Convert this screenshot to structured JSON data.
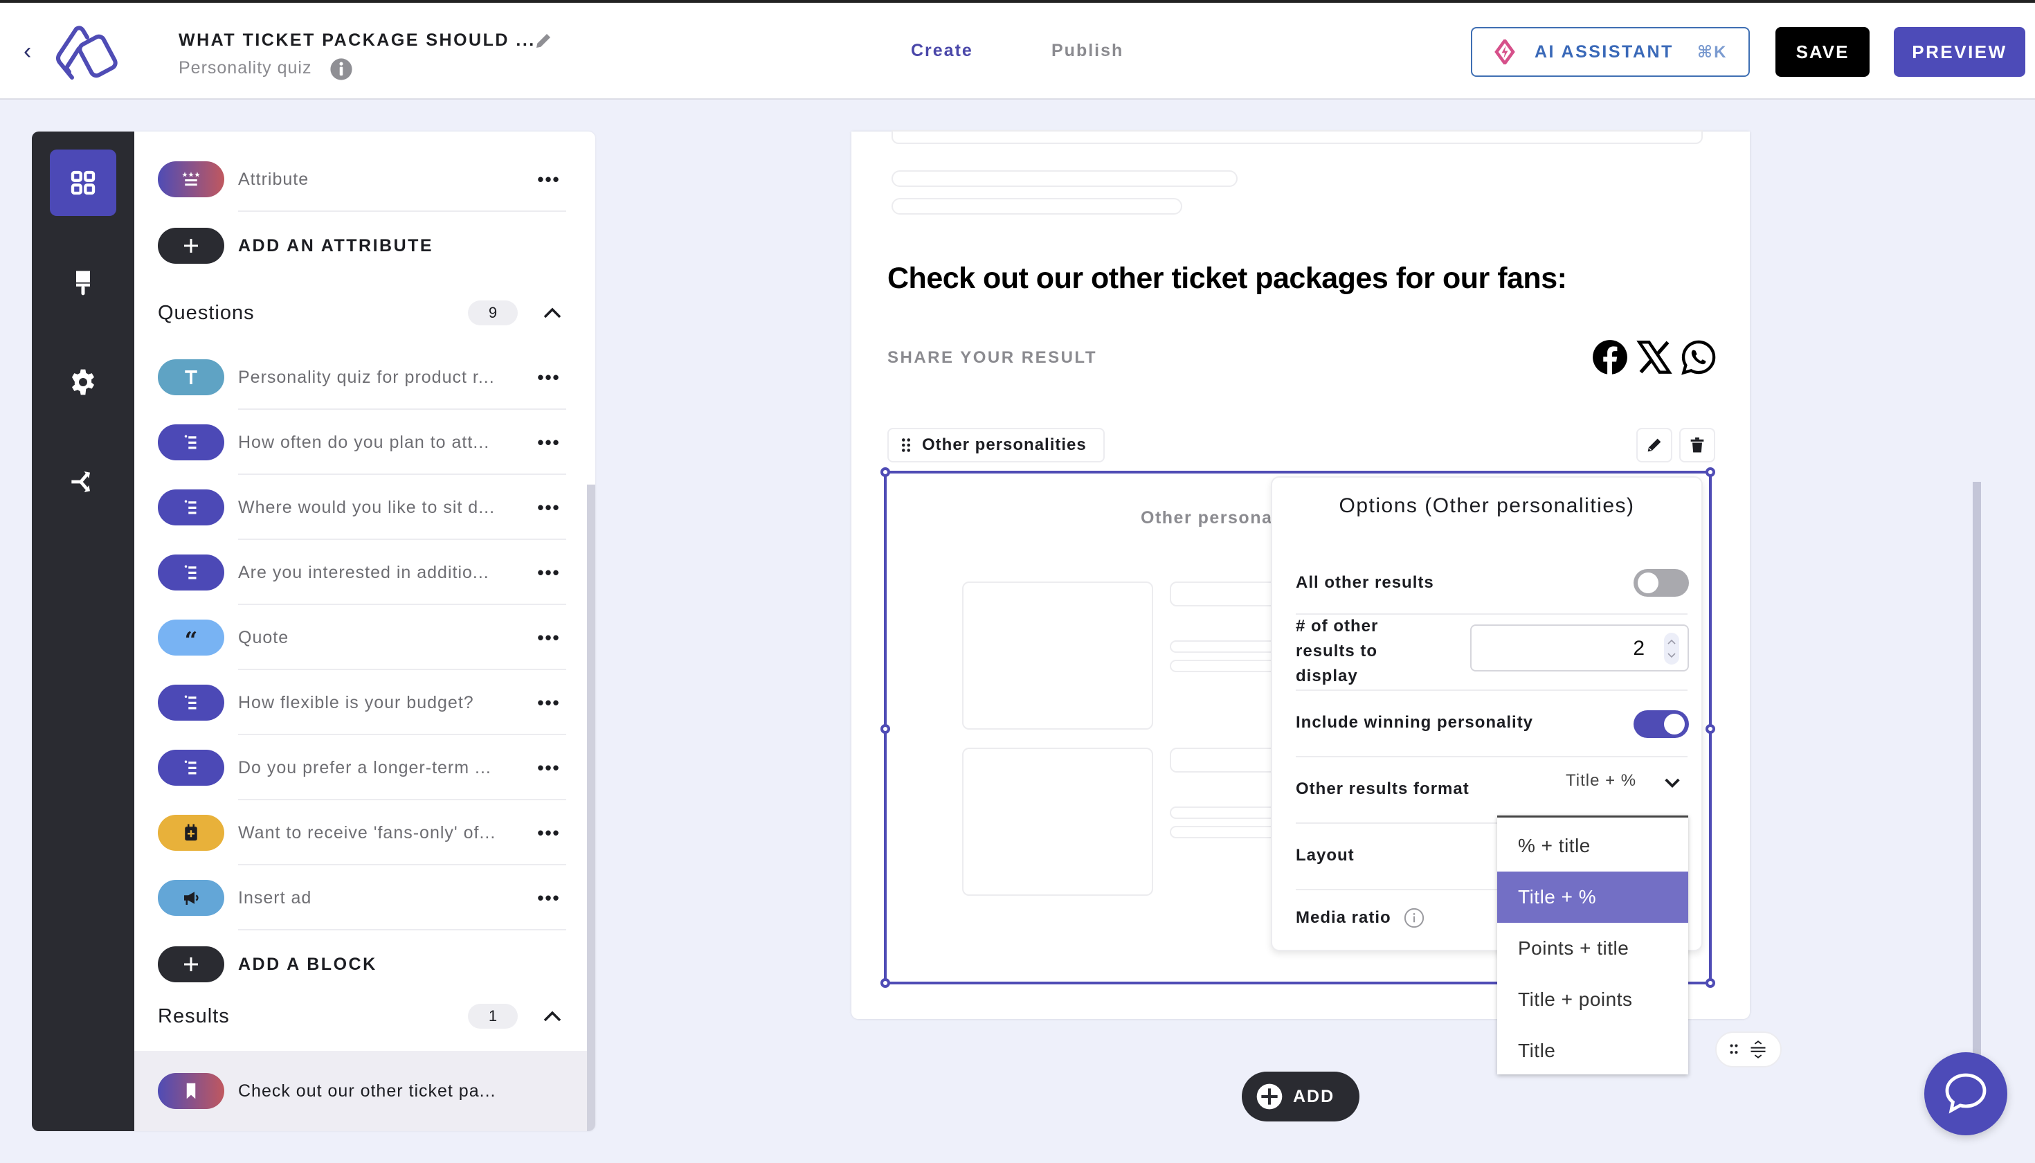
{
  "header": {
    "back_label": "‹",
    "title": "WHAT TICKET PACKAGE SHOULD ...",
    "subtitle": "Personality quiz",
    "tabs": [
      {
        "label": "Create",
        "active": true
      },
      {
        "label": "Publish",
        "active": false
      }
    ],
    "ai_assistant": {
      "label": "AI ASSISTANT",
      "shortcut": "⌘K"
    },
    "save_label": "SAVE",
    "preview_label": "PREVIEW"
  },
  "rail": {
    "items": [
      {
        "icon": "grid-icon",
        "active": true
      },
      {
        "icon": "paint-brush-icon",
        "active": false
      },
      {
        "icon": "gear-icon",
        "active": false
      },
      {
        "icon": "branch-icon",
        "active": false
      }
    ]
  },
  "panel": {
    "attribute": {
      "label": "Attribute",
      "more": "•••"
    },
    "add_attribute_label": "ADD AN ATTRIBUTE",
    "questions": {
      "title": "Questions",
      "count": "9",
      "items": [
        {
          "label": "Personality quiz for product r...",
          "type": "text",
          "more": "•••"
        },
        {
          "label": "How often do you plan to att...",
          "type": "list",
          "more": "•••"
        },
        {
          "label": "Where would you like to sit d...",
          "type": "list",
          "more": "•••"
        },
        {
          "label": "Are you interested in additio...",
          "type": "list",
          "more": "•••"
        },
        {
          "label": "Quote",
          "type": "quote",
          "more": "•••"
        },
        {
          "label": "How flexible is your budget?",
          "type": "list",
          "more": "•••"
        },
        {
          "label": "Do you prefer a longer-term ...",
          "type": "list",
          "more": "•••"
        },
        {
          "label": "Want to receive 'fans-only' of...",
          "type": "form",
          "more": "•••"
        },
        {
          "label": "Insert ad",
          "type": "ad",
          "more": "•••"
        }
      ]
    },
    "add_block_label": "ADD A BLOCK",
    "results": {
      "title": "Results",
      "count": "1",
      "items": [
        {
          "label": "Check out our other ticket pa...",
          "type": "result"
        }
      ]
    }
  },
  "canvas": {
    "heading": "Check out our other ticket packages for our fans:",
    "share_label": "SHARE YOUR RESULT",
    "social": [
      "facebook-icon",
      "x-icon",
      "whatsapp-icon"
    ],
    "block_tag": "Other personalities",
    "block_title_preview": "Other personal"
  },
  "options": {
    "title": "Options (Other personalities)",
    "all_other_results": {
      "label": "All other results",
      "on": false
    },
    "num_results": {
      "label_lines": [
        "# of other",
        "results to",
        "display"
      ],
      "value": "2"
    },
    "include_winning": {
      "label": "Include winning personality",
      "on": true
    },
    "format": {
      "label": "Other results format",
      "value": "Title + %"
    },
    "layout": {
      "label": "Layout"
    },
    "media_ratio": {
      "label": "Media ratio"
    }
  },
  "format_dropdown": {
    "options": [
      "% + title",
      "Title + %",
      "Points + title",
      "Title + points",
      "Title"
    ],
    "selected": "Title + %"
  },
  "bottom": {
    "add_label": "ADD"
  },
  "colors": {
    "accent": "#4d4bb8",
    "dark": "#2a2b31",
    "ai_blue": "#3a69b8",
    "background": "#eef0fa",
    "dropdown_selected": "#736fc5"
  }
}
